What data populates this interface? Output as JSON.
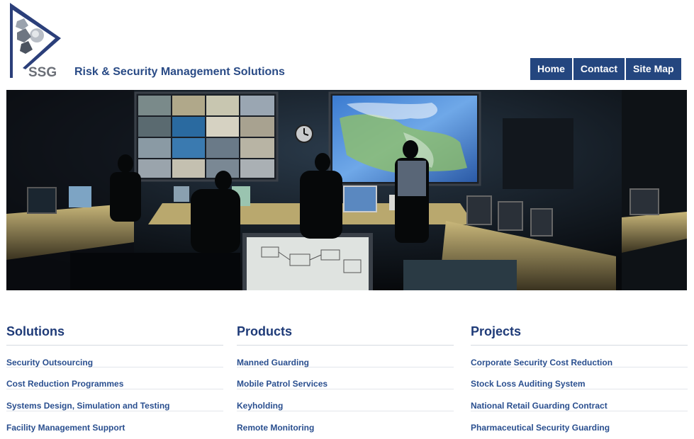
{
  "brand": {
    "logo_text": "SSG",
    "tagline": "Risk & Security Management Solutions",
    "color": "#24467f"
  },
  "nav": {
    "items": [
      {
        "label": "Home"
      },
      {
        "label": "Contact"
      },
      {
        "label": "Site Map"
      }
    ]
  },
  "banner": {
    "description_icon": "security-control-room-photo"
  },
  "columns": [
    {
      "title": "Solutions",
      "links": [
        {
          "label": "Security Outsourcing"
        },
        {
          "label": "Cost Reduction Programmes"
        },
        {
          "label": "Systems Design, Simulation and Testing"
        },
        {
          "label": "Facility Management Support"
        }
      ]
    },
    {
      "title": "Products",
      "links": [
        {
          "label": "Manned Guarding"
        },
        {
          "label": "Mobile Patrol Services"
        },
        {
          "label": "Keyholding"
        },
        {
          "label": "Remote Monitoring"
        }
      ]
    },
    {
      "title": "Projects",
      "links": [
        {
          "label": "Corporate Security Cost Reduction"
        },
        {
          "label": "Stock Loss Auditing System"
        },
        {
          "label": "National Retail Guarding Contract"
        },
        {
          "label": "Pharmaceutical Security Guarding"
        }
      ]
    }
  ]
}
